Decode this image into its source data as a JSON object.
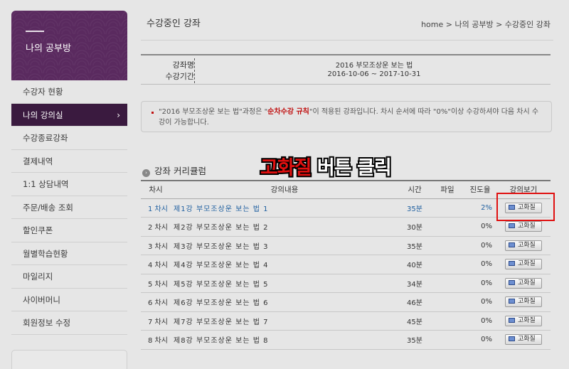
{
  "sidebar": {
    "title": "나의 공부방",
    "items": [
      {
        "label": "수강자 현황"
      },
      {
        "label": "나의 강의실",
        "chevron": "›"
      },
      {
        "label": "수강종료강좌"
      },
      {
        "label": "결제내역"
      },
      {
        "label": "1:1 상담내역"
      },
      {
        "label": "주문/배송 조회"
      },
      {
        "label": "할인쿠폰"
      },
      {
        "label": "월별학습현황"
      },
      {
        "label": "마일리지"
      },
      {
        "label": "사이버머니"
      },
      {
        "label": "회원정보 수정"
      }
    ]
  },
  "header": {
    "title": "수강중인 강좌",
    "breadcrumb": "home > 나의 공부방 > 수강중인 강좌"
  },
  "course": {
    "name_label": "강좌명",
    "name": "2016 부모조상운 보는 법",
    "period_label": "수강기간",
    "period": "2016-10-06 ~ 2017-10-31"
  },
  "notice": {
    "before": "\"2016 부모조상운 보는 법\"과정은 \"",
    "highlight": "순차수강 규칙",
    "after": "\"이 적용된 강좌입니다. 차시 순서에 따라 \"0%\"이상 수강하셔야 다음 차시 수강이 가능합니다."
  },
  "curriculum": {
    "title": "강좌 커리큘럼",
    "columns": [
      "차시",
      "강의내용",
      "시간",
      "파일",
      "진도율",
      "강의보기"
    ],
    "button_label": "고화질",
    "rows": [
      {
        "no": "1 차시",
        "title": "제1강 부모조상운 보는 법 1",
        "time": "35분",
        "file": "",
        "rate": "2%"
      },
      {
        "no": "2 차시",
        "title": "제2강 부모조상운 보는 법 2",
        "time": "30분",
        "file": "",
        "rate": "0%"
      },
      {
        "no": "3 차시",
        "title": "제3강 부모조상운 보는 법 3",
        "time": "35분",
        "file": "",
        "rate": "0%"
      },
      {
        "no": "4 차시",
        "title": "제4강 부모조상운 보는 법 4",
        "time": "40분",
        "file": "",
        "rate": "0%"
      },
      {
        "no": "5 차시",
        "title": "제5강 부모조상운 보는 법 5",
        "time": "34분",
        "file": "",
        "rate": "0%"
      },
      {
        "no": "6 차시",
        "title": "제6강 부모조상운 보는 법 6",
        "time": "46분",
        "file": "",
        "rate": "0%"
      },
      {
        "no": "7 차시",
        "title": "제7강 부모조상운 보는 법 7",
        "time": "45분",
        "file": "",
        "rate": "0%"
      },
      {
        "no": "8 차시",
        "title": "제8강 부모조상운 보는 법 8",
        "time": "35분",
        "file": "",
        "rate": "0%"
      }
    ]
  },
  "annotation": {
    "red_text": "고화질",
    "white_text": " 버튼 클릭"
  },
  "colors": {
    "accent": "#5a2a5f",
    "active_menu": "#3a1a3f",
    "highlight": "#e01010",
    "link_blue": "#2060a0"
  }
}
